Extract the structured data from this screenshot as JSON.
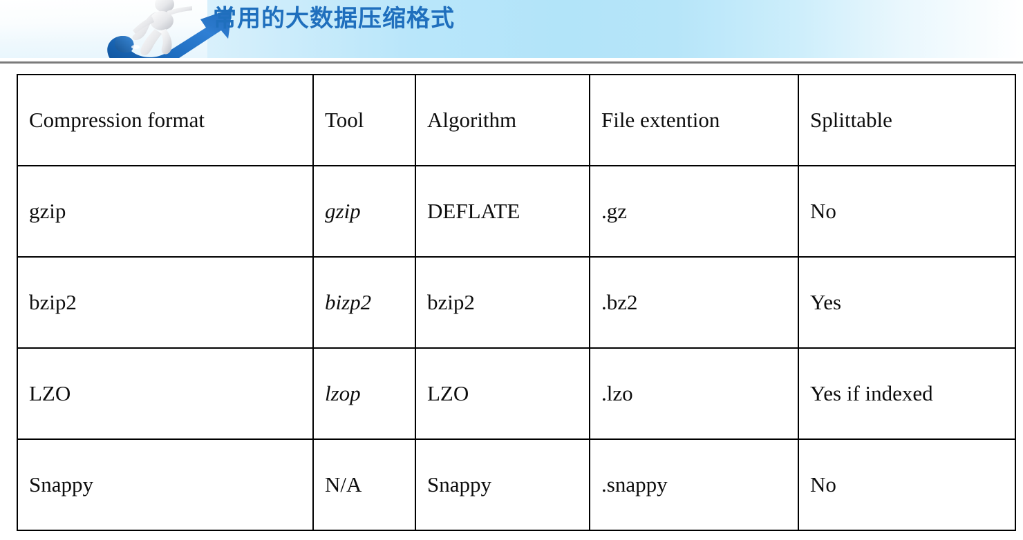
{
  "banner": {
    "title": "常用的大数据压缩格式",
    "title_color": "#1f6fbd",
    "graphic_name": "blue-arrow-with-running-figure",
    "gradient_start": "#ffffff",
    "gradient_mid": "#b2e4f9",
    "gradient_end": "#ffffff",
    "rule_color": "#7b7b7b"
  },
  "table": {
    "headers": [
      "Compression format",
      "Tool",
      "Algorithm",
      "File extention",
      "Splittable"
    ],
    "rows": [
      {
        "format": "gzip",
        "tool": "gzip",
        "tool_italic": true,
        "algorithm": "DEFLATE",
        "extension": ".gz",
        "splittable": "No"
      },
      {
        "format": "bzip2",
        "tool": "bizp2",
        "tool_italic": true,
        "algorithm": "bzip2",
        "extension": ".bz2",
        "splittable": "Yes"
      },
      {
        "format": "LZO",
        "tool": "lzop",
        "tool_italic": true,
        "algorithm": "LZO",
        "extension": ".lzo",
        "splittable": "Yes if indexed"
      },
      {
        "format": "Snappy",
        "tool": "N/A",
        "tool_italic": false,
        "algorithm": "Snappy",
        "extension": ".snappy",
        "splittable": "No"
      }
    ]
  }
}
